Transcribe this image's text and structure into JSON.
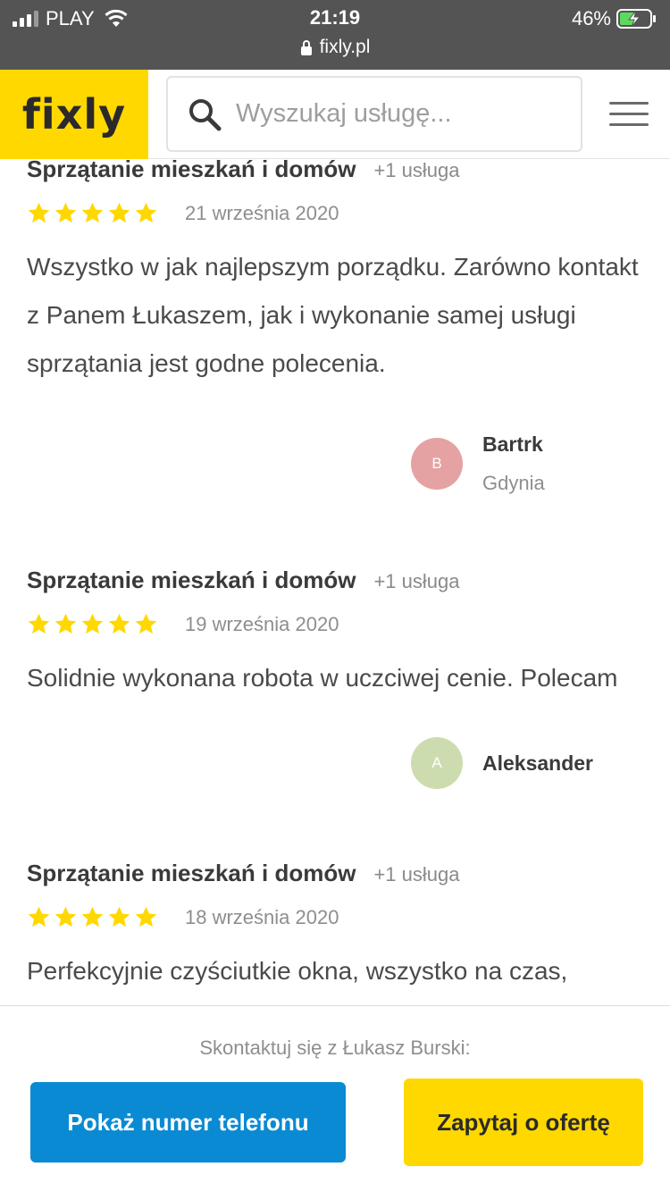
{
  "status_bar": {
    "carrier": "PLAY",
    "time": "21:19",
    "battery": "46%",
    "url": "fixly.pl"
  },
  "header": {
    "logo": "fixly",
    "search_placeholder": "Wyszukaj usługę..."
  },
  "reviews": [
    {
      "service": "Sprzątanie mieszkań i domów",
      "more": "+1 usługa",
      "stars": 5,
      "date": "21 września 2020",
      "text": "Wszystko w jak najlepszym porządku. Zarówno kontakt z Panem Łukaszem, jak i wykonanie samej usługi sprzątania jest godne polecenia.",
      "author": "Bartrk",
      "city": "Gdynia",
      "avatar_letter": "B",
      "avatar_color": "#e5a2a2"
    },
    {
      "service": "Sprzątanie mieszkań i domów",
      "more": "+1 usługa",
      "stars": 5,
      "date": "19 września 2020",
      "text": "Solidnie wykonana robota w uczciwej cenie. Polecam",
      "author": "Aleksander",
      "avatar_letter": "A",
      "avatar_color": "#cddcae"
    },
    {
      "service": "Sprzątanie mieszkań i domów",
      "more": "+1 usługa",
      "stars": 5,
      "date": "18 września 2020",
      "text": "Perfekcyjnie czyściutkie okna, wszystko na czas,"
    }
  ],
  "contact": {
    "label": "Skontaktuj się z Łukasz Burski:",
    "phone_button": "Pokaż numer telefonu",
    "offer_button": "Zapytaj o ofertę"
  },
  "colors": {
    "brand_yellow": "#ffd800",
    "phone_blue": "#0a8ad3",
    "star_yellow": "#ffd800"
  }
}
